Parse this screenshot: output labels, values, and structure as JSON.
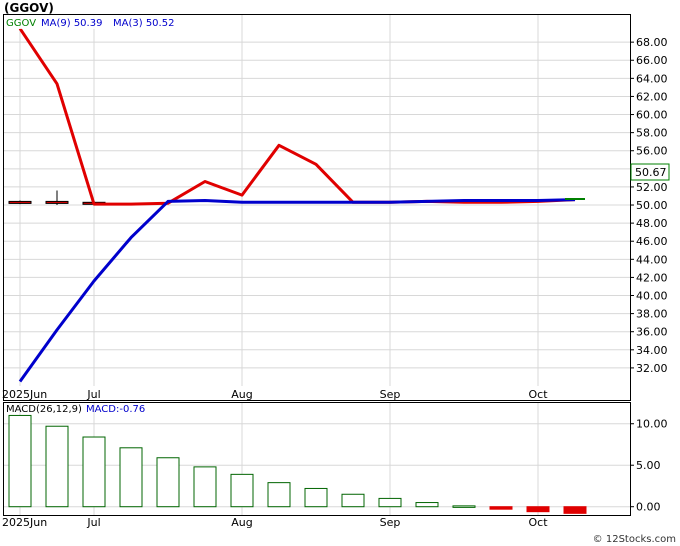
{
  "title": "(GGOV)",
  "watermark": "© 12Stocks.com",
  "colors": {
    "ma_fast": "#e00000",
    "ma_slow": "#0000cc",
    "legend_symbol": "#008000",
    "legend_text": "#0000cc",
    "macd_up": "#006400",
    "macd_down": "#e00000",
    "price_box_border": "#008000"
  },
  "chart_data": [
    {
      "type": "line",
      "panel": "price",
      "symbol": "GGOV",
      "legend": {
        "symbol": "GGOV",
        "ma_fast_text": "MA(9)  50.39",
        "ma_slow_text": "MA(3)  50.52"
      },
      "last_price_label": "50.67",
      "last_price": 50.67,
      "ylim": [
        30.0,
        71.0
      ],
      "yticks": [
        32,
        34,
        36,
        38,
        40,
        42,
        44,
        46,
        48,
        50,
        52,
        54,
        56,
        58,
        60,
        62,
        64,
        66,
        68
      ],
      "ytick_labels": [
        "32.00",
        "34.00",
        "36.00",
        "38.00",
        "40.00",
        "42.00",
        "44.00",
        "46.00",
        "48.00",
        "50.00",
        "52.00",
        "54.00",
        "56.00",
        "58.00",
        "60.00",
        "62.00",
        "64.00",
        "66.00",
        "68.00"
      ],
      "xlim": [
        0,
        115
      ],
      "xticks": [
        {
          "x": 0,
          "label": "2025Jun"
        },
        {
          "x": 20,
          "label": "Jul"
        },
        {
          "x": 60,
          "label": "Aug"
        },
        {
          "x": 100,
          "label": "Sep"
        },
        {
          "x": 140,
          "label": "Oct"
        }
      ],
      "series": [
        {
          "key": "ma_fast",
          "x": [
            0,
            10,
            20,
            30,
            40,
            50,
            60,
            70,
            80,
            90,
            100,
            110,
            120,
            130,
            140,
            150
          ],
          "y": [
            69.5,
            63.4,
            50.1,
            50.1,
            50.2,
            52.6,
            51.1,
            56.6,
            54.5,
            50.3,
            50.3,
            50.4,
            50.3,
            50.3,
            50.4,
            50.6
          ]
        },
        {
          "key": "ma_slow",
          "x": [
            0,
            10,
            20,
            30,
            40,
            50,
            60,
            70,
            80,
            90,
            100,
            110,
            120,
            130,
            140,
            150
          ],
          "y": [
            30.5,
            36.2,
            41.6,
            46.4,
            50.4,
            50.5,
            50.3,
            50.3,
            50.3,
            50.3,
            50.3,
            50.4,
            50.5,
            50.5,
            50.5,
            50.6
          ]
        }
      ],
      "candles": [
        {
          "x": 0,
          "open": 50.2,
          "close": 50.4,
          "high": 50.5,
          "low": 50.1
        },
        {
          "x": 10,
          "open": 50.2,
          "close": 50.4,
          "high": 51.6,
          "low": 50.0
        },
        {
          "x": 20,
          "open": 50.2,
          "close": 50.3,
          "high": 50.4,
          "low": 50.1
        }
      ]
    },
    {
      "type": "bar",
      "panel": "macd",
      "label": "MACD(26,12,9)",
      "value_label": "MACD:-0.76",
      "ylim": [
        -1.0,
        12.5
      ],
      "yticks": [
        0,
        5,
        10
      ],
      "ytick_labels": [
        "0.00",
        "5.00",
        "10.00"
      ],
      "bars": [
        {
          "x": 0,
          "v": 11.0
        },
        {
          "x": 10,
          "v": 9.7
        },
        {
          "x": 20,
          "v": 8.4
        },
        {
          "x": 30,
          "v": 7.1
        },
        {
          "x": 40,
          "v": 5.9
        },
        {
          "x": 50,
          "v": 4.8
        },
        {
          "x": 60,
          "v": 3.9
        },
        {
          "x": 70,
          "v": 2.9
        },
        {
          "x": 80,
          "v": 2.2
        },
        {
          "x": 90,
          "v": 1.5
        },
        {
          "x": 100,
          "v": 1.0
        },
        {
          "x": 110,
          "v": 0.5
        },
        {
          "x": 120,
          "v": 0.1
        },
        {
          "x": 130,
          "v": -0.3
        },
        {
          "x": 140,
          "v": -0.6
        },
        {
          "x": 150,
          "v": -0.8
        }
      ]
    }
  ]
}
